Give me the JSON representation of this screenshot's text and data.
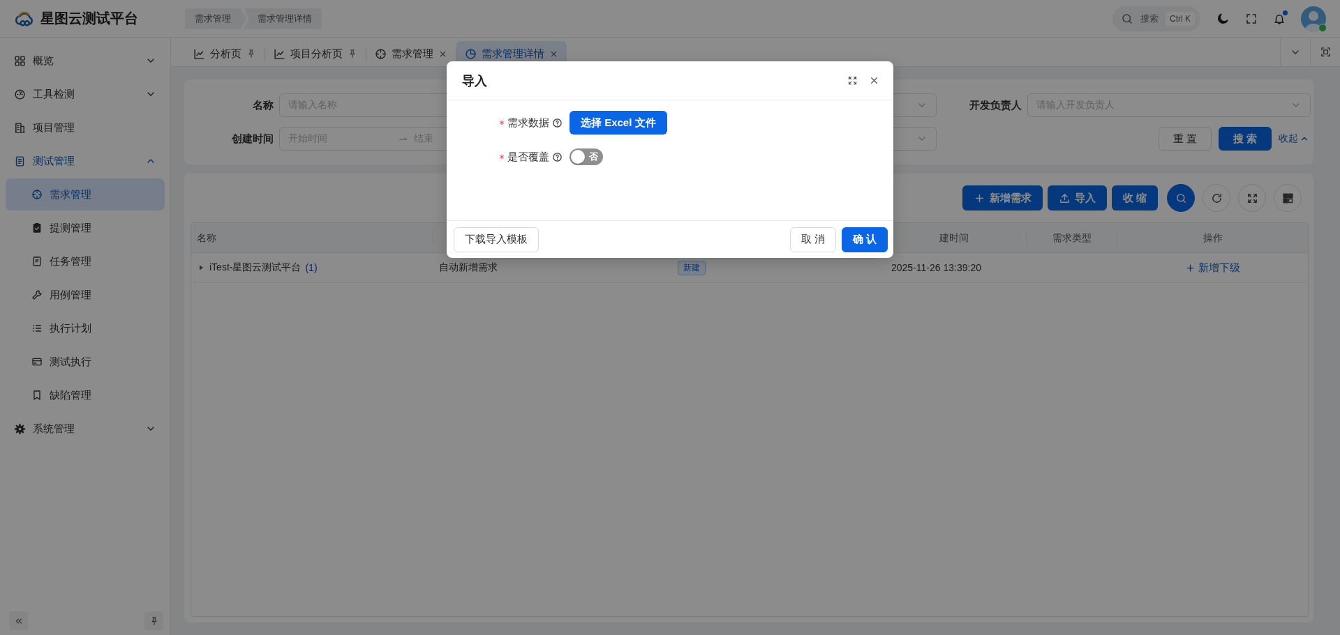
{
  "header": {
    "app_name": "星图云测试平台",
    "breadcrumb": [
      "需求管理",
      "需求管理详情"
    ],
    "search": {
      "placeholder": "搜索",
      "shortcut": "Ctrl K"
    },
    "has_unread": true,
    "avatar": {
      "online": true
    }
  },
  "sidebar": {
    "items": [
      {
        "label": "概览",
        "kind": "group",
        "expanded": false,
        "selected": false
      },
      {
        "label": "工具检测",
        "kind": "group",
        "expanded": false,
        "selected": false
      },
      {
        "label": "项目管理",
        "kind": "link",
        "selected": false
      },
      {
        "label": "测试管理",
        "kind": "group",
        "expanded": true,
        "selected": true,
        "children": [
          {
            "label": "需求管理",
            "selected": true
          },
          {
            "label": "提测管理",
            "selected": false
          },
          {
            "label": "任务管理",
            "selected": false
          },
          {
            "label": "用例管理",
            "selected": false
          },
          {
            "label": "执行计划",
            "selected": false
          },
          {
            "label": "测试执行",
            "selected": false
          },
          {
            "label": "缺陷管理",
            "selected": false
          }
        ]
      },
      {
        "label": "系统管理",
        "kind": "group",
        "expanded": false,
        "selected": false
      }
    ]
  },
  "tabs": [
    {
      "label": "分析页",
      "pinned": true,
      "selected": false
    },
    {
      "label": "项目分析页",
      "pinned": true,
      "selected": false
    },
    {
      "label": "需求管理",
      "pinned": false,
      "selected": false
    },
    {
      "label": "需求管理详情",
      "pinned": false,
      "selected": true
    }
  ],
  "filters": {
    "fields": [
      {
        "kind": "text",
        "label": "名称",
        "placeholder": "请输入名称"
      },
      {
        "kind": "select"
      },
      {
        "kind": "select",
        "label": "开发负责人",
        "placeholder": "请输入开发负责人"
      },
      {
        "kind": "range",
        "label": "创建时间",
        "start_placeholder": "开始时间",
        "end_placeholder": "结束"
      },
      {
        "kind": "select"
      }
    ],
    "actions": [
      {
        "label": "重 置",
        "kind": "default"
      },
      {
        "label": "搜 索",
        "kind": "primary"
      }
    ],
    "collapse_link": "收起"
  },
  "table": {
    "toolbar": [
      {
        "label": "新增需求",
        "kind": "add"
      },
      {
        "label": "导入",
        "kind": "upload"
      },
      {
        "label": "收 缩",
        "kind": "plain"
      }
    ],
    "columns": [
      "名称",
      "建时间",
      "需求类型",
      "操作"
    ],
    "rows": [
      {
        "name": "iTest-星图云测试平台",
        "count": "(1)",
        "expanded": false,
        "description": "自动新增需求",
        "status": "新建",
        "created": "2025-11-26 13:39:20",
        "action": "新增下级"
      }
    ]
  },
  "dialog": {
    "title": "导入",
    "fields": [
      {
        "kind": "file",
        "label": "需求数据",
        "required": true,
        "button": "选择 Excel 文件"
      },
      {
        "kind": "switch",
        "label": "是否覆盖",
        "required": true,
        "on": false,
        "text": "否"
      }
    ],
    "footer": {
      "left": "下载导入模板",
      "cancel": "取 消",
      "ok": "确 认"
    }
  }
}
